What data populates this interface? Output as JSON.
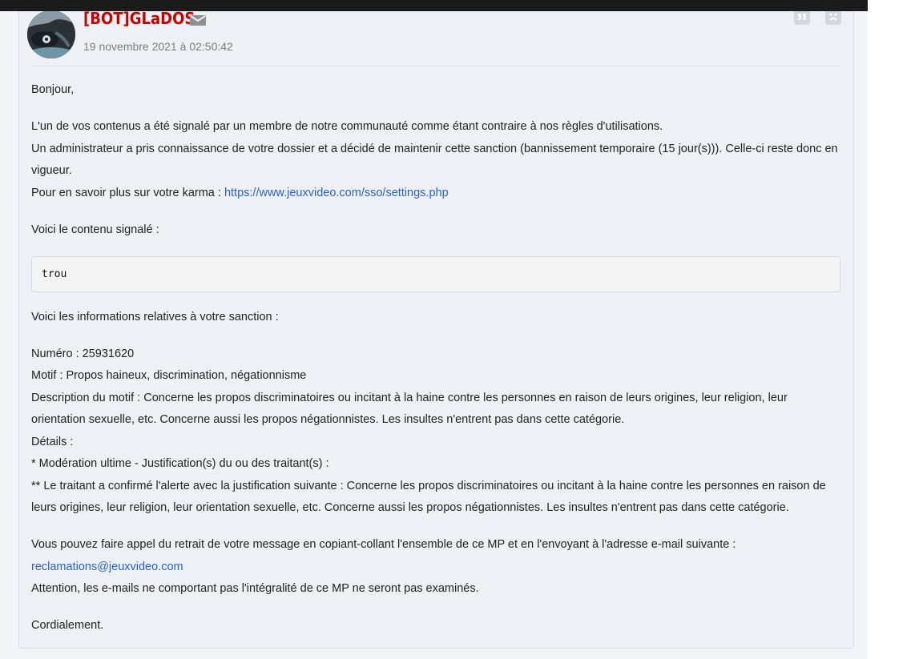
{
  "post": {
    "author": "[BOT]GLaDOS",
    "date": "19 novembre 2021 à 02:50:42",
    "actions": {
      "quote_icon": "quote-icon",
      "alert_icon": "alert-icon",
      "mail_icon": "mail-icon"
    },
    "message": {
      "greeting": "Bonjour,",
      "intro_line1": "L'un de vos contenus a été signalé par un membre de notre communauté comme étant contraire à nos règles d'utilisations.",
      "intro_line2": "Un administrateur a pris connaissance de votre dossier et a décidé de maintenir cette sanction (bannissement temporaire (15 jour(s))). Celle-ci reste donc en vigueur.",
      "karma_text": "Pour en savoir plus sur votre karma : ",
      "karma_link": "https://www.jeuxvideo.com/sso/settings.php",
      "content_intro": "Voici le contenu signalé :",
      "reported_content": "trou",
      "sanction_intro": "Voici les informations relatives à votre sanction :",
      "numero": "Numéro : 25931620",
      "motif": "Motif : Propos haineux, discrimination, négationnisme",
      "description": "Description du motif : Concerne les propos discriminatoires ou incitant à la haine contre les personnes en raison de leurs origines, leur religion, leur orientation sexuelle, etc. Concerne aussi les propos négationnistes. Les insultes n'entrent pas dans cette catégorie.",
      "details": "Détails :",
      "moderation": "* Modération ultime - Justification(s) du ou des traitant(s) :",
      "traitant": "** Le traitant a confirmé l'alerte avec la justification suivante : Concerne les propos discriminatoires ou incitant à la haine contre les personnes en raison de leurs origines, leur religion, leur orientation sexuelle, etc. Concerne aussi les propos négationnistes. Les insultes n'entrent pas dans cette catégorie.",
      "appeal": "Vous pouvez faire appel du retrait de votre message en copiant-collant l'ensemble de ce MP et en l'envoyant à l'adresse e-mail suivante :",
      "email_link": "reclamations@jeuxvideo.com",
      "warning": "Attention, les e-mails ne comportant pas l'intégralité de ce MP ne seront pas examinés.",
      "closing": "Cordialement."
    }
  },
  "colors": {
    "author": "#c40000",
    "link": "#2c61c9",
    "card_bg": "#edf0f5",
    "page_bg": "#f4f5f8"
  }
}
